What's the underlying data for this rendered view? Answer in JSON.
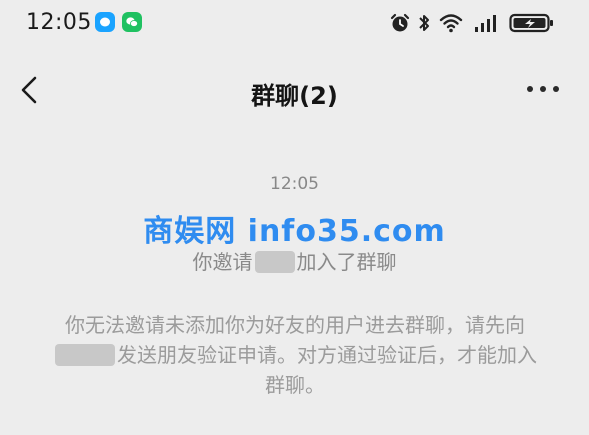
{
  "status_bar": {
    "time": "12:05",
    "apps": [
      "qq-icon",
      "wechat-icon"
    ],
    "indicators": [
      "alarm-icon",
      "bluetooth-icon",
      "wifi-icon",
      "signal-icon",
      "battery-charging-icon"
    ]
  },
  "nav": {
    "title": "群聊(2)",
    "back_icon": "chevron-left-icon",
    "more_icon": "more-dots-icon"
  },
  "chat": {
    "time": "12:05",
    "watermark": "商娱网 info35.com",
    "invite_prefix": "你邀请",
    "invite_suffix": "加入了群聊",
    "notice_part1": "你无法邀请未添加你为好友的用户进去群聊，请先向",
    "notice_part2": "发送朋友验证申请。对方通过验证后，才能加入群聊。"
  },
  "colors": {
    "background": "#ededed",
    "watermark": "#2f8cf0",
    "system_text": "#8a8a8a"
  }
}
